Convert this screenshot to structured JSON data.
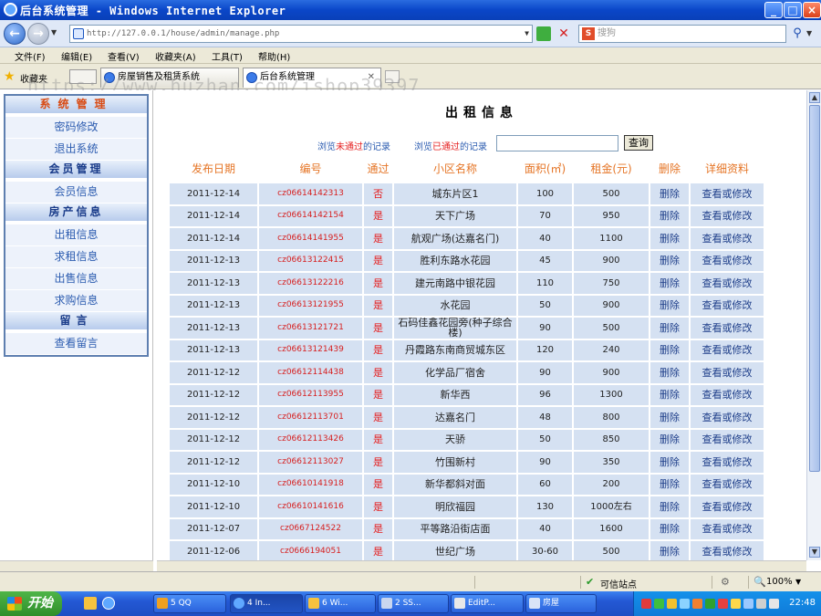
{
  "window": {
    "title": "后台系统管理 - Windows Internet Explorer",
    "minimize": "_",
    "maximize": "□",
    "close": "×"
  },
  "address_bar": {
    "url": "http://127.0.0.1/house/admin/manage.php",
    "search_placeholder": "搜狗"
  },
  "menu": [
    "文件(F)",
    "编辑(E)",
    "查看(V)",
    "收藏夹(A)",
    "工具(T)",
    "帮助(H)"
  ],
  "favorites_label": "收藏夹",
  "tabs": [
    {
      "label": "房屋销售及租赁系统"
    },
    {
      "label": "后台系统管理"
    }
  ],
  "watermark": "https://www.huzhan.com/ishop39397",
  "sidebar": {
    "sections": [
      {
        "title": "系统管理",
        "items": [
          "密码修改",
          "退出系统"
        ]
      },
      {
        "title": "会员管理",
        "items": [
          "会员信息"
        ]
      },
      {
        "title": "房产信息",
        "items": [
          "出租信息",
          "求租信息",
          "出售信息",
          "求购信息"
        ]
      },
      {
        "title": "留言",
        "items": [
          "查看留言"
        ]
      }
    ]
  },
  "main": {
    "title": "出租信息",
    "browse_unapproved": {
      "pre": "浏览",
      "em": "未通过",
      "post": "的记录"
    },
    "browse_approved": {
      "pre": "浏览",
      "em": "已通过",
      "post": "的记录"
    },
    "search_value": "",
    "query_button": "查询",
    "columns": [
      "发布日期",
      "编号",
      "通过",
      "小区名称",
      "面积(㎡)",
      "租金(元)",
      "删除",
      "详细资料"
    ],
    "rows": [
      {
        "date": "2011-12-14",
        "code": "cz06614142313",
        "passed": "否",
        "community": "城东片区1",
        "area": "100",
        "rent": "500",
        "delete": "删除",
        "detail": "查看或修改"
      },
      {
        "date": "2011-12-14",
        "code": "cz06614142154",
        "passed": "是",
        "community": "天下广场",
        "area": "70",
        "rent": "950",
        "delete": "删除",
        "detail": "查看或修改"
      },
      {
        "date": "2011-12-14",
        "code": "cz06614141955",
        "passed": "是",
        "community": "航观广场(达嘉名门)",
        "area": "40",
        "rent": "1100",
        "delete": "删除",
        "detail": "查看或修改"
      },
      {
        "date": "2011-12-13",
        "code": "cz06613122415",
        "passed": "是",
        "community": "胜利东路水花园",
        "area": "45",
        "rent": "900",
        "delete": "删除",
        "detail": "查看或修改"
      },
      {
        "date": "2011-12-13",
        "code": "cz06613122216",
        "passed": "是",
        "community": "建元南路中银花园",
        "area": "110",
        "rent": "750",
        "delete": "删除",
        "detail": "查看或修改"
      },
      {
        "date": "2011-12-13",
        "code": "cz06613121955",
        "passed": "是",
        "community": "水花园",
        "area": "50",
        "rent": "900",
        "delete": "删除",
        "detail": "查看或修改"
      },
      {
        "date": "2011-12-13",
        "code": "cz06613121721",
        "passed": "是",
        "community": "石码佳鑫花园旁(种子综合楼)",
        "area": "90",
        "rent": "500",
        "delete": "删除",
        "detail": "查看或修改"
      },
      {
        "date": "2011-12-13",
        "code": "cz06613121439",
        "passed": "是",
        "community": "丹霞路东南商贸城东区",
        "area": "120",
        "rent": "240",
        "delete": "删除",
        "detail": "查看或修改"
      },
      {
        "date": "2011-12-12",
        "code": "cz06612114438",
        "passed": "是",
        "community": "化学品厂宿舍",
        "area": "90",
        "rent": "900",
        "delete": "删除",
        "detail": "查看或修改"
      },
      {
        "date": "2011-12-12",
        "code": "cz06612113955",
        "passed": "是",
        "community": "新华西",
        "area": "96",
        "rent": "1300",
        "delete": "删除",
        "detail": "查看或修改"
      },
      {
        "date": "2011-12-12",
        "code": "cz06612113701",
        "passed": "是",
        "community": "达嘉名门",
        "area": "48",
        "rent": "800",
        "delete": "删除",
        "detail": "查看或修改"
      },
      {
        "date": "2011-12-12",
        "code": "cz06612113426",
        "passed": "是",
        "community": "天骄",
        "area": "50",
        "rent": "850",
        "delete": "删除",
        "detail": "查看或修改"
      },
      {
        "date": "2011-12-12",
        "code": "cz06612113027",
        "passed": "是",
        "community": "竹围新村",
        "area": "90",
        "rent": "350",
        "delete": "删除",
        "detail": "查看或修改"
      },
      {
        "date": "2011-12-10",
        "code": "cz06610141918",
        "passed": "是",
        "community": "新华都斜对面",
        "area": "60",
        "rent": "200",
        "delete": "删除",
        "detail": "查看或修改"
      },
      {
        "date": "2011-12-10",
        "code": "cz06610141616",
        "passed": "是",
        "community": "明欣福园",
        "area": "130",
        "rent": "1000左右",
        "delete": "删除",
        "detail": "查看或修改"
      },
      {
        "date": "2011-12-07",
        "code": "cz0667124522",
        "passed": "是",
        "community": "平等路沿街店面",
        "area": "40",
        "rent": "1600",
        "delete": "删除",
        "detail": "查看或修改"
      },
      {
        "date": "2011-12-06",
        "code": "cz0666194051",
        "passed": "是",
        "community": "世纪广场",
        "area": "30-60",
        "rent": "500",
        "delete": "删除",
        "detail": "查看或修改"
      }
    ]
  },
  "status_bar": {
    "zone": "可信站点",
    "zoom": "100%"
  },
  "taskbar": {
    "start": "开始",
    "tasks": [
      "5 QQ",
      "4 In...",
      "6 Wi...",
      "2 SS...",
      "EditP...",
      "房屋"
    ],
    "clock": "22:48"
  }
}
